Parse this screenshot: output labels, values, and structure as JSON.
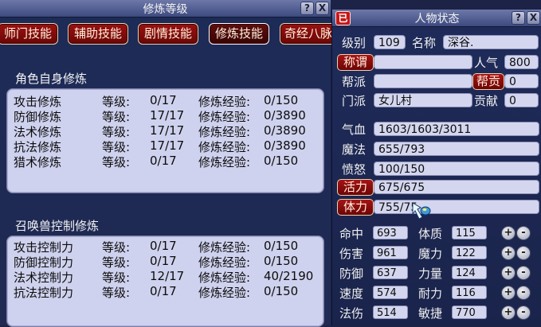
{
  "cultivation_window": {
    "title": "修炼等级",
    "help_glyph": "?",
    "close_glyph": "X",
    "tabs": [
      {
        "label": "师门技能"
      },
      {
        "label": "辅助技能"
      },
      {
        "label": "剧情技能"
      },
      {
        "label": "修炼技能",
        "active": true
      },
      {
        "label": "奇经八脉"
      }
    ],
    "self_section": {
      "title": "角色自身修炼",
      "rows": [
        {
          "name": "攻击修炼",
          "level_label": "等级:",
          "level": "0/17",
          "exp_label": "修炼经验:",
          "exp": "0/150"
        },
        {
          "name": "防御修炼",
          "level_label": "等级:",
          "level": "17/17",
          "exp_label": "修炼经验:",
          "exp": "0/3890"
        },
        {
          "name": "法术修炼",
          "level_label": "等级:",
          "level": "17/17",
          "exp_label": "修炼经验:",
          "exp": "0/3890"
        },
        {
          "name": "抗法修炼",
          "level_label": "等级:",
          "level": "17/17",
          "exp_label": "修炼经验:",
          "exp": "0/3890"
        },
        {
          "name": "猎术修炼",
          "level_label": "等级:",
          "level": "0/17",
          "exp_label": "修炼经验:",
          "exp": "0/150"
        }
      ]
    },
    "pet_section": {
      "title": "召唤兽控制修炼",
      "rows": [
        {
          "name": "攻击控制力",
          "level_label": "等级:",
          "level": "0/17",
          "exp_label": "修炼经验:",
          "exp": "0/150"
        },
        {
          "name": "防御控制力",
          "level_label": "等级:",
          "level": "0/17",
          "exp_label": "修炼经验:",
          "exp": "0/150"
        },
        {
          "name": "法术控制力",
          "level_label": "等级:",
          "level": "12/17",
          "exp_label": "修炼经验:",
          "exp": "40/2190"
        },
        {
          "name": "抗法控制力",
          "level_label": "等级:",
          "level": "0/17",
          "exp_label": "修炼经验:",
          "exp": "0/150"
        }
      ]
    }
  },
  "status_window": {
    "title": "人物状态",
    "logo_glyph": "已",
    "help_glyph": "?",
    "close_glyph": "X",
    "level_label": "级别",
    "level": "109",
    "name_label": "名称",
    "name": "深谷.",
    "title_button": "称谓",
    "title_value": "",
    "popularity_label": "人气",
    "popularity": "800",
    "gang_label": "帮派",
    "gang": "",
    "gang_contrib_button": "帮贡",
    "gang_contrib": "0",
    "sect_label": "门派",
    "sect": "女儿村",
    "contribution_label": "贡献",
    "contribution": "0",
    "hp_label": "气血",
    "hp": "1603/1603/3011",
    "mp_label": "魔法",
    "mp": "655/793",
    "rage_label": "愤怒",
    "rage": "100/150",
    "vitality_button": "活力",
    "vitality": "675/675",
    "stamina_button": "体力",
    "stamina": "755/75",
    "stats": [
      {
        "label": "命中",
        "value": "693",
        "attr_label": "体质",
        "attr_value": "115"
      },
      {
        "label": "伤害",
        "value": "961",
        "attr_label": "魔力",
        "attr_value": "122"
      },
      {
        "label": "防御",
        "value": "637",
        "attr_label": "力量",
        "attr_value": "124"
      },
      {
        "label": "速度",
        "value": "574",
        "attr_label": "耐力",
        "attr_value": "116"
      },
      {
        "label": "法伤",
        "value": "514",
        "attr_label": "敏捷",
        "attr_value": "770"
      }
    ],
    "plus_glyph": "+",
    "minus_glyph": "-"
  },
  "colors": {
    "window_bg": "#1d2b57",
    "panel_bg": "#cfd2ee",
    "tab_red": "#9a1111",
    "field_bg": "#d3d6ee"
  },
  "icons": [
    "help-icon",
    "close-icon",
    "logo-icon",
    "plus-icon",
    "minus-icon",
    "cursor-icon"
  ]
}
